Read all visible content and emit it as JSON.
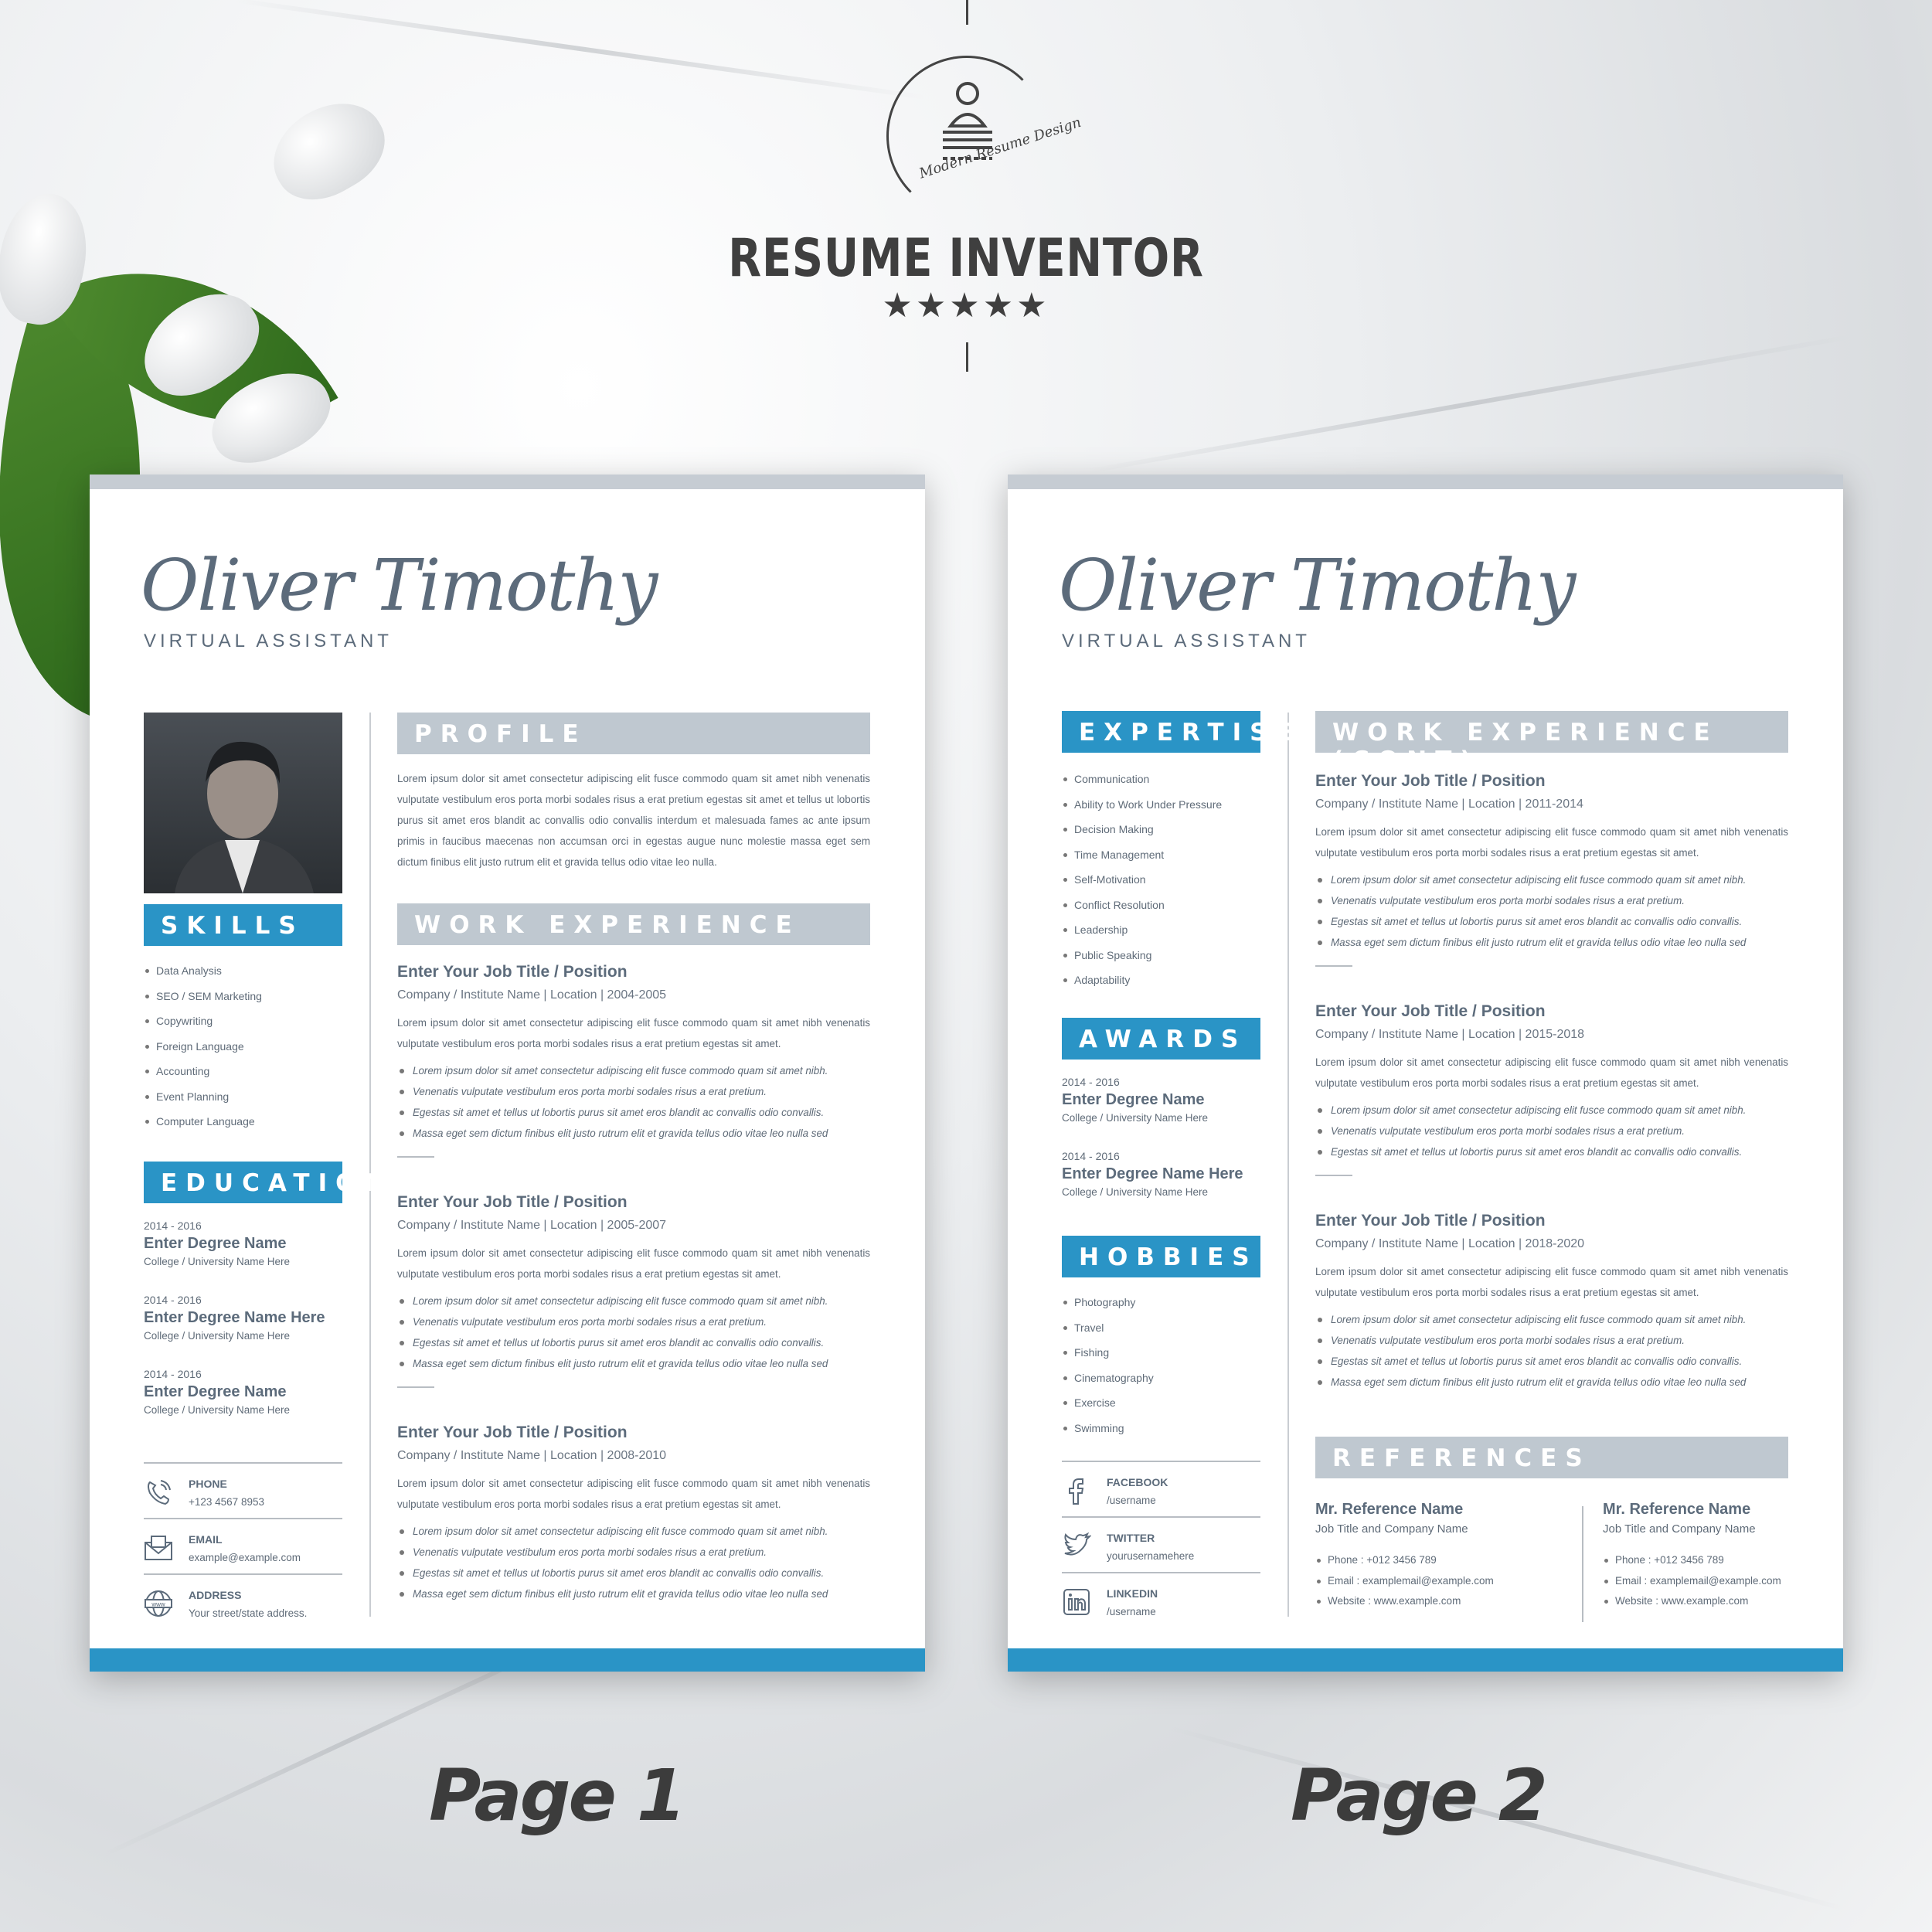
{
  "brand": {
    "name": "RESUME INVENTOR",
    "tagline": "Modern Resume Design",
    "stars": "★★★★★",
    "rating": 5
  },
  "labels": {
    "page1": "Page 1",
    "page2": "Page 2"
  },
  "colors": {
    "accent": "#2a94c6",
    "header_gray": "#bfc8d0",
    "text": "#5c6b7b"
  },
  "person": {
    "name": "Oliver Timothy",
    "role": "VIRTUAL ASSISTANT"
  },
  "page1": {
    "skills_title": "SKILLS",
    "skills": [
      "Data Analysis",
      "SEO / SEM Marketing",
      "Copywriting",
      "Foreign Language",
      "Accounting",
      "Event Planning",
      "Computer Language"
    ],
    "education_title": "EDUCATION",
    "education": [
      {
        "date": "2014 - 2016",
        "degree": "Enter Degree Name",
        "college": "College / University Name Here"
      },
      {
        "date": "2014 - 2016",
        "degree": "Enter Degree Name Here",
        "college": "College / University Name Here"
      },
      {
        "date": "2014 - 2016",
        "degree": "Enter Degree Name",
        "college": "College / University Name Here"
      }
    ],
    "contacts": [
      {
        "icon": "phone-icon",
        "label": "PHONE",
        "value": "+123 4567 8953"
      },
      {
        "icon": "envelope-icon",
        "label": "EMAIL",
        "value": "example@example.com"
      },
      {
        "icon": "globe-www-icon",
        "label": "ADDRESS",
        "value": "Your street/state address."
      }
    ],
    "profile_title": "PROFILE",
    "profile_text": "Lorem ipsum dolor sit amet consectetur adipiscing elit fusce commodo quam sit amet nibh venenatis vulputate vestibulum eros porta morbi sodales risus a erat pretium egestas sit amet et tellus ut lobortis purus sit amet eros blandit ac convallis odio convallis interdum et malesuada fames ac ante ipsum primis in faucibus maecenas non accumsan orci in egestas augue nunc molestie massa eget sem dictum finibus  elit justo rutrum elit et gravida tellus odio vitae leo nulla.",
    "work_title": "WORK EXPERIENCE",
    "jobs": [
      {
        "title": "Enter Your Job Title / Position",
        "meta": "Company / Institute Name  |  Location  |  2004-2005",
        "desc": "Lorem ipsum dolor sit amet consectetur adipiscing elit fusce commodo quam sit amet nibh venenatis vulputate vestibulum eros porta morbi sodales risus a erat pretium egestas sit amet.",
        "bullets": [
          "Lorem ipsum dolor sit amet consectetur adipiscing elit fusce commodo quam sit amet nibh.",
          "Venenatis vulputate vestibulum eros porta morbi sodales risus a erat pretium.",
          "Egestas sit amet et tellus ut lobortis purus sit amet eros blandit ac convallis odio convallis.",
          "Massa eget sem dictum finibus  elit justo rutrum elit et gravida tellus odio vitae leo nulla sed"
        ]
      },
      {
        "title": "Enter Your Job Title / Position",
        "meta": "Company / Institute Name  |  Location  |  2005-2007",
        "desc": "Lorem ipsum dolor sit amet consectetur adipiscing elit fusce commodo quam sit amet nibh venenatis vulputate vestibulum eros porta morbi sodales risus a erat pretium egestas sit amet.",
        "bullets": [
          "Lorem ipsum dolor sit amet consectetur adipiscing elit fusce commodo quam sit amet nibh.",
          "Venenatis vulputate vestibulum eros porta morbi sodales risus a erat pretium.",
          "Egestas sit amet et tellus ut lobortis purus sit amet eros blandit ac convallis odio convallis.",
          "Massa eget sem dictum finibus  elit justo rutrum elit et gravida tellus odio vitae leo nulla sed"
        ]
      },
      {
        "title": "Enter Your Job Title / Position",
        "meta": "Company / Institute Name  |  Location  |  2008-2010",
        "desc": "Lorem ipsum dolor sit amet consectetur adipiscing elit fusce commodo quam sit amet nibh venenatis vulputate vestibulum eros porta morbi sodales risus a erat pretium egestas sit amet.",
        "bullets": [
          "Lorem ipsum dolor sit amet consectetur adipiscing elit fusce commodo quam sit amet nibh.",
          "Venenatis vulputate vestibulum eros porta morbi sodales risus a erat pretium.",
          "Egestas sit amet et tellus ut lobortis purus sit amet eros blandit ac convallis odio convallis.",
          "Massa eget sem dictum finibus  elit justo rutrum elit et gravida tellus odio vitae leo nulla sed"
        ]
      }
    ]
  },
  "page2": {
    "expertise_title": "EXPERTISE",
    "expertise": [
      "Communication",
      "Ability to Work Under Pressure",
      "Decision Making",
      "Time Management",
      "Self-Motivation",
      "Conflict Resolution",
      "Leadership",
      "Public Speaking",
      "Adaptability"
    ],
    "awards_title": "AWARDS",
    "awards": [
      {
        "date": "2014 - 2016",
        "degree": "Enter Degree Name",
        "college": "College / University Name Here"
      },
      {
        "date": "2014 - 2016",
        "degree": "Enter Degree Name Here",
        "college": "College / University Name Here"
      }
    ],
    "hobbies_title": "HOBBIES",
    "hobbies": [
      "Photography",
      "Travel",
      "Fishing",
      "Cinematography",
      "Exercise",
      "Swimming"
    ],
    "socials": [
      {
        "icon": "facebook-icon",
        "label": "FACEBOOK",
        "value": "/username"
      },
      {
        "icon": "twitter-icon",
        "label": "TWITTER",
        "value": "yourusernamehere"
      },
      {
        "icon": "linkedin-icon",
        "label": "LINKEDIN",
        "value": "/username"
      }
    ],
    "work_title": "WORK EXPERIENCE (CONT)",
    "jobs": [
      {
        "title": "Enter Your Job Title / Position",
        "meta": "Company / Institute Name  |  Location  |  2011-2014",
        "desc": "Lorem ipsum dolor sit amet consectetur adipiscing elit fusce commodo quam sit amet nibh venenatis vulputate vestibulum eros porta morbi sodales risus a erat pretium egestas sit amet.",
        "bullets": [
          "Lorem ipsum dolor sit amet consectetur adipiscing elit fusce commodo quam sit amet nibh.",
          "Venenatis vulputate vestibulum eros porta morbi sodales risus a erat pretium.",
          "Egestas sit amet et tellus ut lobortis purus sit amet eros blandit ac convallis odio convallis.",
          "Massa eget sem dictum finibus  elit justo rutrum elit et gravida tellus odio vitae leo nulla sed"
        ]
      },
      {
        "title": "Enter Your Job Title / Position",
        "meta": "Company / Institute Name  |  Location  |  2015-2018",
        "desc": "Lorem ipsum dolor sit amet consectetur adipiscing elit fusce commodo quam sit amet nibh venenatis vulputate vestibulum eros porta morbi sodales risus a erat pretium egestas sit amet.",
        "bullets": [
          "Lorem ipsum dolor sit amet consectetur adipiscing elit fusce commodo quam sit amet nibh.",
          "Venenatis vulputate vestibulum eros porta morbi sodales risus a erat pretium.",
          "Egestas sit amet et tellus ut lobortis purus sit amet eros blandit ac convallis odio convallis."
        ]
      },
      {
        "title": "Enter Your Job Title / Position",
        "meta": "Company / Institute Name  |  Location  |  2018-2020",
        "desc": "Lorem ipsum dolor sit amet consectetur adipiscing elit fusce commodo quam sit amet nibh venenatis vulputate vestibulum eros porta morbi sodales risus a erat pretium egestas sit amet.",
        "bullets": [
          "Lorem ipsum dolor sit amet consectetur adipiscing elit fusce commodo quam sit amet nibh.",
          "Venenatis vulputate vestibulum eros porta morbi sodales risus a erat pretium.",
          "Egestas sit amet et tellus ut lobortis purus sit amet eros blandit ac convallis odio convallis.",
          "Massa eget sem dictum finibus  elit justo rutrum elit et gravida tellus odio vitae leo nulla sed"
        ]
      }
    ],
    "references_title": "REFERENCES",
    "references": [
      {
        "name": "Mr. Reference Name",
        "job": "Job Title and Company Name",
        "phone": "Phone : +012 3456 789",
        "email": "Email : examplemail@example.com",
        "website": "Website : www.example.com"
      },
      {
        "name": "Mr. Reference Name",
        "job": "Job Title and Company Name",
        "phone": "Phone : +012 3456 789",
        "email": "Email : examplemail@example.com",
        "website": "Website : www.example.com"
      }
    ]
  }
}
